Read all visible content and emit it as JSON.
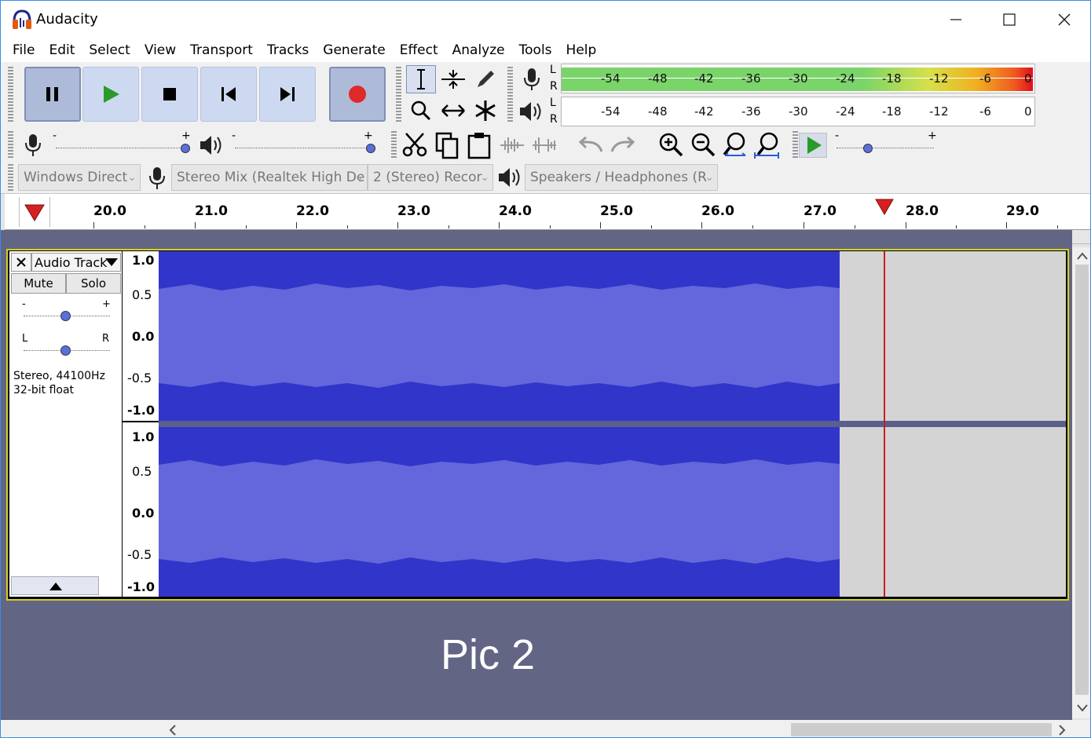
{
  "window": {
    "title": "Audacity"
  },
  "menu": [
    "File",
    "Edit",
    "Select",
    "View",
    "Transport",
    "Tracks",
    "Generate",
    "Effect",
    "Analyze",
    "Tools",
    "Help"
  ],
  "transport": {
    "buttons": [
      "pause",
      "play",
      "stop",
      "skip-to-start",
      "skip-to-end",
      "record"
    ]
  },
  "tools": [
    "selection-tool",
    "envelope-tool",
    "draw-tool",
    "zoom-tool",
    "time-shift-tool",
    "multi-tool"
  ],
  "meters": {
    "record_channels": [
      "L",
      "R"
    ],
    "play_channels": [
      "L",
      "R"
    ],
    "scale": [
      "-54",
      "-48",
      "-42",
      "-36",
      "-30",
      "-24",
      "-18",
      "-12",
      "-6",
      "0"
    ]
  },
  "devices": {
    "host": "Windows Direct",
    "recording_device": "Stereo Mix (Realtek High De",
    "recording_channels": "2 (Stereo) Recor",
    "playback_device": "Speakers / Headphones (R"
  },
  "sliders": {
    "minus": "-",
    "plus": "+",
    "pan_left": "L",
    "pan_right": "R"
  },
  "ruler": {
    "labels": [
      "20.0",
      "21.0",
      "22.0",
      "23.0",
      "24.0",
      "25.0",
      "26.0",
      "27.0",
      "28.0",
      "29.0"
    ]
  },
  "track": {
    "name": "Audio Track",
    "mute_label": "Mute",
    "solo_label": "Solo",
    "info_line1": "Stereo, 44100Hz",
    "info_line2": "32-bit float",
    "scale": [
      "1.0",
      "0.5",
      "0.0",
      "-0.5",
      "-1.0"
    ]
  },
  "overlay_text": "Pic 2",
  "colors": {
    "waveform_bg": "#3235c9",
    "waveform_fill": "#6466dc",
    "selected_border": "#d6d21c",
    "cursor": "#c81e1e",
    "tracks_bg": "#636585"
  }
}
